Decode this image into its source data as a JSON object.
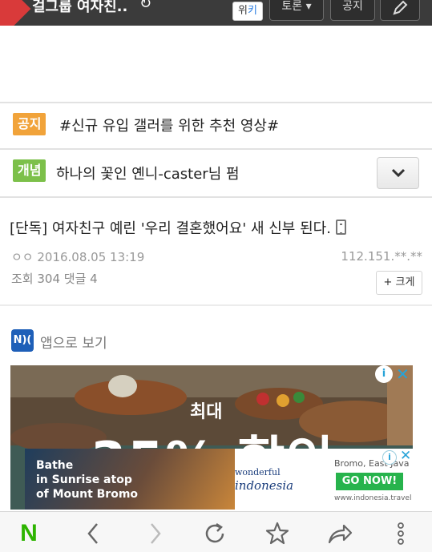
{
  "header": {
    "title": "걸그룹 여자친..",
    "wiki_label_a": "위",
    "wiki_label_b": "키",
    "discuss_label": "토론 ▾",
    "notice_label": "공지"
  },
  "notice_row": {
    "tag": "공지",
    "text": "#신규 유입 갤러를 위한 추천 영상#"
  },
  "concept_row": {
    "tag": "개념",
    "text": "하나의 꽃인 옌니-caster님 펌"
  },
  "article": {
    "title": "[단독] 여자친구 예린 '우리 결혼했어요' 새 신부 된다.",
    "author_date": "ㅇㅇ 2016.08.05 13:19",
    "ip": "112.151.**.**",
    "stats": "조회 304 댓글 4",
    "font_button": "+ 크게"
  },
  "app_link": {
    "icon_text": "N)(",
    "label": "앱으로 보기"
  },
  "ad": {
    "headline_small": "최대",
    "headline_big": "35% 할인",
    "info_icon": "i",
    "close_icon": "✕",
    "banner": {
      "text_line1": "Bathe",
      "text_line2": "in Sunrise atop",
      "text_line3": "of Mount Bromo",
      "logo_line1": "wonderful",
      "logo_line2": "indonesia",
      "location": "Bromo, East Java",
      "cta": "GO NOW!",
      "url": "www.indonesia.travel"
    }
  },
  "toolbar": {
    "home_label": "N"
  },
  "colors": {
    "notice_tag": "#f1a33a",
    "concept_tag": "#7cc04a",
    "naver_green": "#2db400",
    "ad_accent": "#27a3d8"
  }
}
